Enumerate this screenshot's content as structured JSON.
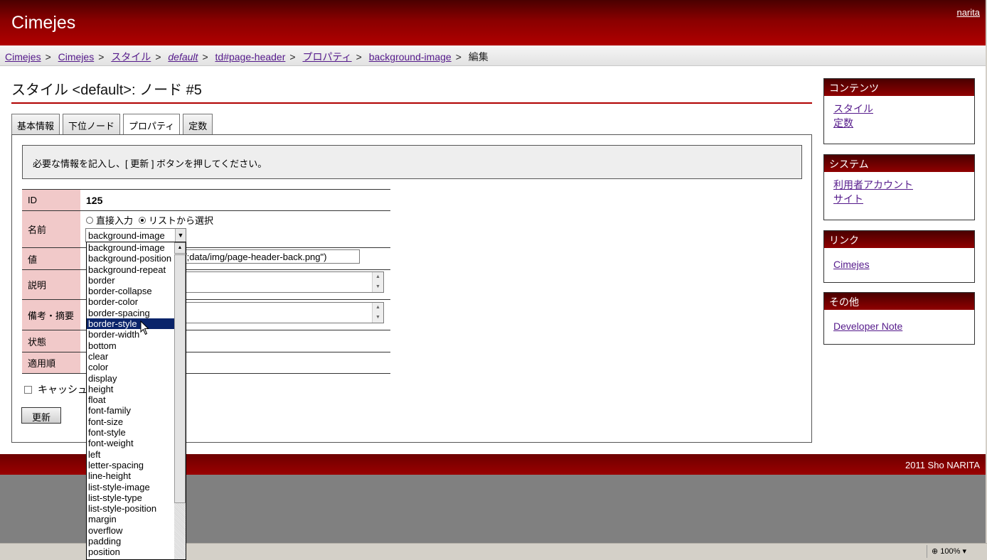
{
  "header": {
    "site_title": "Cimejes",
    "user": "narita"
  },
  "breadcrumb": [
    {
      "label": "Cimejes",
      "italic": false
    },
    {
      "label": "Cimejes",
      "italic": false
    },
    {
      "label": "スタイル",
      "italic": false
    },
    {
      "label": "default",
      "italic": true
    },
    {
      "label": "td#page-header",
      "italic": false
    },
    {
      "label": "プロパティ",
      "italic": false
    },
    {
      "label": "background-image",
      "italic": false
    }
  ],
  "breadcrumb_separator": ">",
  "breadcrumb_current": "編集",
  "page_title": "スタイル <default>: ノード #5",
  "tabs": [
    {
      "label": "基本情報",
      "active": false
    },
    {
      "label": "下位ノード",
      "active": false
    },
    {
      "label": "プロパティ",
      "active": true
    },
    {
      "label": "定数",
      "active": false
    }
  ],
  "notice": "必要な情報を記入し、[ 更新 ] ボタンを押してください。",
  "form": {
    "labels": {
      "id": "ID",
      "name": "名前",
      "value": "値",
      "description": "説明",
      "notes": "備考・摘要",
      "status": "状態",
      "order": "適用順"
    },
    "id_value": "125",
    "radio_direct": "直接入力",
    "radio_list": "リストから選択",
    "radio_selected": "list",
    "name_selected": "background-image",
    "value_text": "/;data/img/page-header-back.png\")",
    "cache_label": "キャッシュ",
    "update_button": "更新"
  },
  "dropdown": {
    "options": [
      "background-image",
      "background-position",
      "background-repeat",
      "border",
      "border-collapse",
      "border-color",
      "border-spacing",
      "border-style",
      "border-width",
      "bottom",
      "clear",
      "color",
      "display",
      "height",
      "float",
      "font-family",
      "font-size",
      "font-style",
      "font-weight",
      "left",
      "letter-spacing",
      "line-height",
      "list-style-image",
      "list-style-type",
      "list-style-position",
      "margin",
      "overflow",
      "padding",
      "position"
    ],
    "highlighted": "border-style"
  },
  "sidebar": [
    {
      "title": "コンテンツ",
      "links": [
        "スタイル",
        "定数"
      ]
    },
    {
      "title": "システム",
      "links": [
        "利用者アカウント",
        "サイト"
      ]
    },
    {
      "title": "リンク",
      "links": [
        "Cimejes"
      ]
    },
    {
      "title": "その他",
      "links": [
        "Developer Note"
      ]
    }
  ],
  "footer": "2011 Sho NARITA",
  "statusbar": {
    "zoom": "100%"
  },
  "colors": {
    "brand": "#9a0000",
    "label_bg": "#f1c9c9",
    "selection": "#0a246a"
  }
}
